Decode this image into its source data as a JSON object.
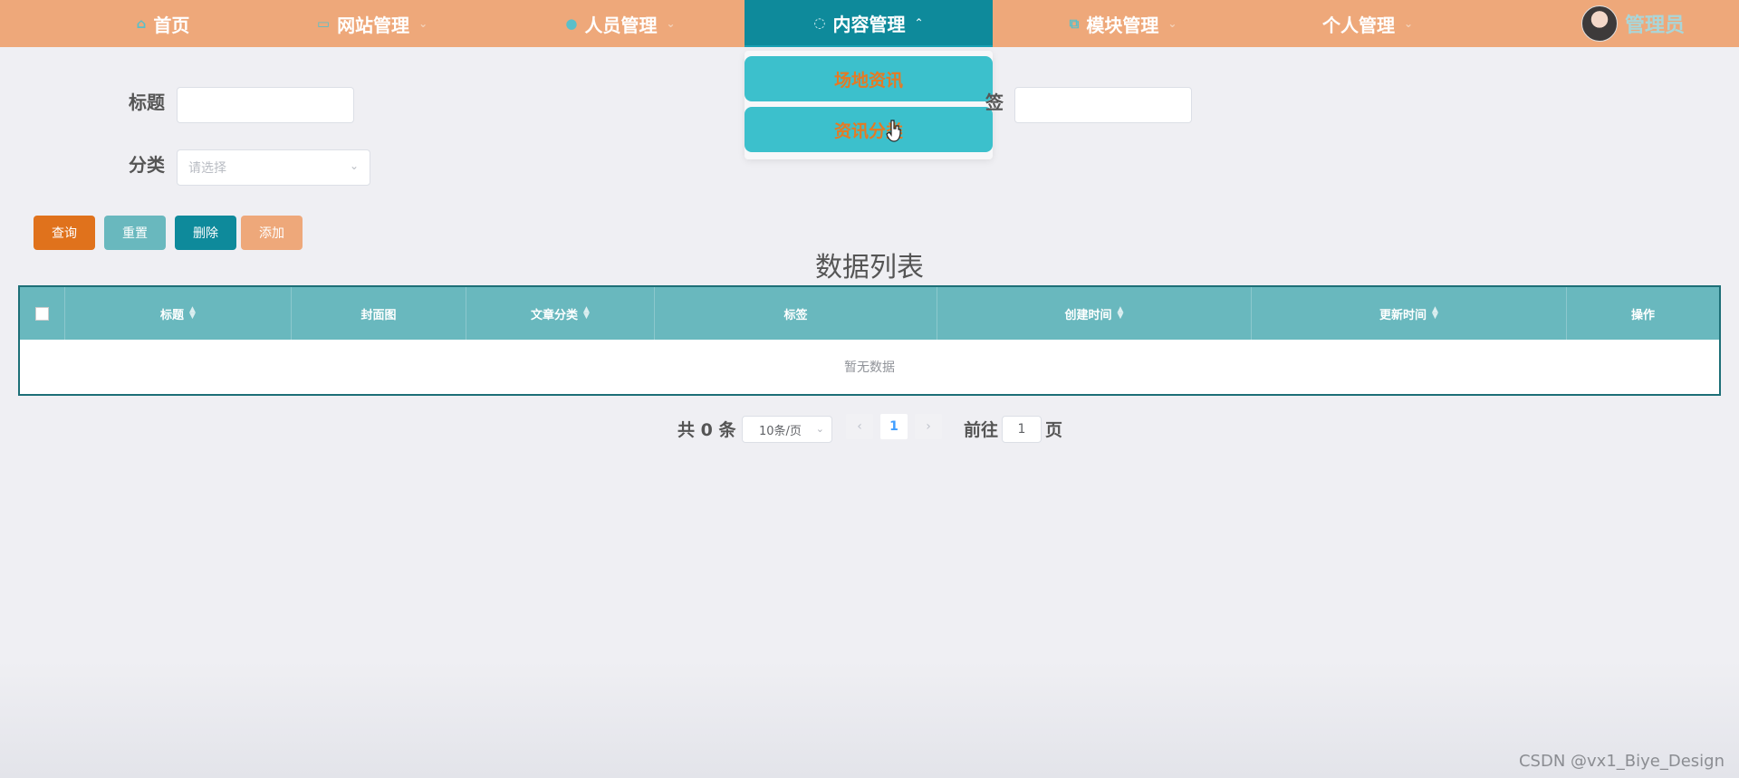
{
  "nav": {
    "items": [
      {
        "label": "首页",
        "icon": "home-icon",
        "glyph": "⌂",
        "has_chevron": false
      },
      {
        "label": "网站管理",
        "icon": "monitor-icon",
        "glyph": "▭",
        "has_chevron": true
      },
      {
        "label": "人员管理",
        "icon": "user-icon",
        "glyph": "●",
        "has_chevron": true
      },
      {
        "label": "内容管理",
        "icon": "chat-icon",
        "glyph": "◌",
        "has_chevron": true,
        "active": true
      },
      {
        "label": "模块管理",
        "icon": "copy-icon",
        "glyph": "⧉",
        "has_chevron": true
      },
      {
        "label": "个人管理",
        "icon": "",
        "glyph": "",
        "has_chevron": true
      }
    ],
    "chevron_down": "⌄",
    "chevron_up": "⌃",
    "user_name": "管理员"
  },
  "dropdown": {
    "items": [
      "场地资讯",
      "资讯分类"
    ]
  },
  "search": {
    "title_label": "标题",
    "tag_label": "签",
    "category_label": "分类",
    "category_placeholder": "请选择"
  },
  "actions": {
    "query": "查询",
    "reset": "重置",
    "delete": "删除",
    "add": "添加"
  },
  "table": {
    "title": "数据列表",
    "columns": [
      "标题",
      "封面图",
      "文章分类",
      "标签",
      "创建时间",
      "更新时间",
      "操作"
    ],
    "empty_text": "暂无数据"
  },
  "pagination": {
    "total_text": "共 0 条",
    "page_size": "10条/页",
    "current_page": "1",
    "goto_prefix": "前往",
    "goto_value": "1",
    "goto_suffix": "页"
  },
  "watermark": "CSDN @vx1_Biye_Design",
  "colors": {
    "nav_bg": "#eea87a",
    "nav_active": "#0e8a9b",
    "dropdown_item": "#3cc0cc",
    "dropdown_text": "#e57a23",
    "btn_query": "#e0721c",
    "btn_reset": "#69b8be",
    "btn_delete": "#0e8a9b",
    "btn_add": "#eea87a",
    "table_header": "#69b8be"
  }
}
